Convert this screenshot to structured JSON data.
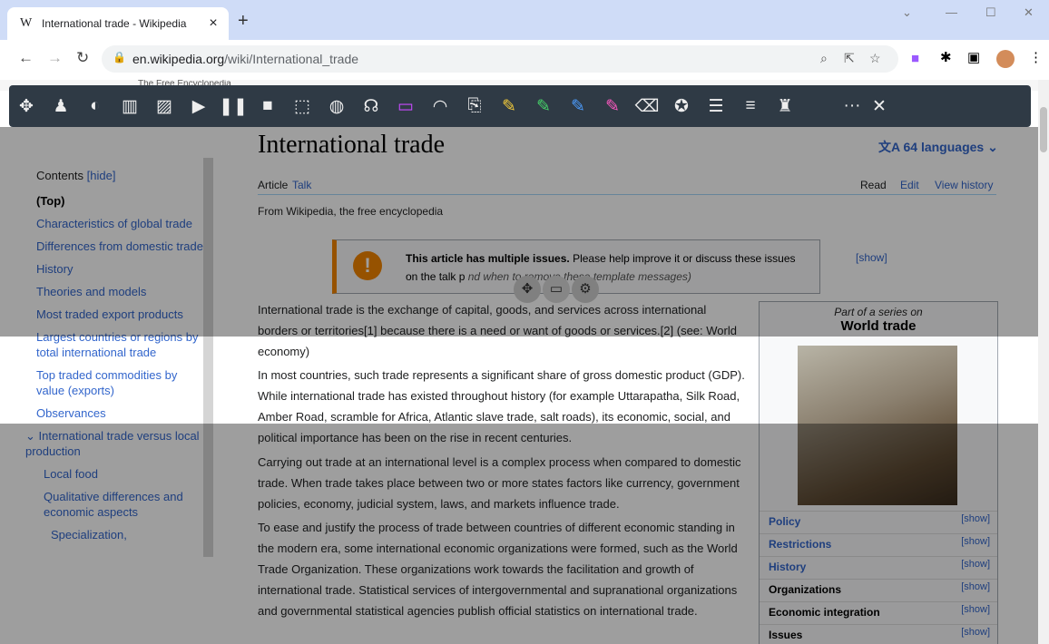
{
  "browser": {
    "tab_title": "International trade - Wikipedia",
    "tab_favicon": "W",
    "tab_close": "×",
    "new_tab": "+",
    "url_host": "en.wikipedia.org",
    "url_path": "/wiki/International_trade",
    "window_controls": [
      "—",
      "☐",
      "✕"
    ]
  },
  "wiki_header_text": "The Free Encyclopedia",
  "toolbar_more": "···",
  "toolbar_close": "✕",
  "sidebar": {
    "contents_label": "Contents",
    "hide": "[hide]",
    "items": [
      "(Top)",
      "Characteristics of global trade",
      "Differences from domestic trade",
      "History",
      "Theories and models",
      "Most traded export products",
      "Largest countries or regions by total international trade",
      "Top traded commodities by value (exports)",
      "Observances",
      "International trade versus local production",
      "Local food",
      "Qualitative differences and economic aspects",
      "Specialization,"
    ]
  },
  "article": {
    "title": "International trade",
    "languages": "64 languages",
    "tab_article": "Article",
    "tab_talk": "Talk",
    "tab_read": "Read",
    "tab_edit": "Edit",
    "tab_history": "View history",
    "tagline": "From Wikipedia, the free encyclopedia",
    "notice_bold": "This article has multiple issues.",
    "notice_text": " Please help improve it or discuss these issues on the talk p",
    "notice_italic": "nd when to remove these template messages)",
    "notice_show": "[show]",
    "para1": "International trade is the exchange of capital, goods, and services across international borders or territories[1] because there is a need or want of goods or services.[2] (see: World economy)",
    "para2": "In most countries, such trade represents a significant share of gross domestic product (GDP). While international trade has existed throughout history (for example Uttarapatha, Silk Road, Amber Road, scramble for Africa, Atlantic slave trade, salt roads), its economic, social, and political importance has been on the rise in recent centuries.",
    "para3": "Carrying out trade at an international level is a complex process when compared to domestic trade. When trade takes place between two or more states factors like currency, government policies, economy, judicial system, laws, and markets influence trade.",
    "para4": "To ease and justify the process of trade between countries of different economic standing in the modern era, some international economic organizations were formed, such as the World Trade Organization. These organizations work towards the facilitation and growth of international trade. Statistical services of intergovernmental and supranational organizations and governmental statistical agencies publish official statistics on international trade."
  },
  "infobox": {
    "pre": "Part of a series on",
    "title": "World trade",
    "rows": [
      {
        "label": "Policy",
        "show": "[show]"
      },
      {
        "label": "Restrictions",
        "show": "[show]"
      },
      {
        "label": "History",
        "show": "[show]"
      },
      {
        "label": "Organizations",
        "show": "[show]"
      },
      {
        "label": "Economic integration",
        "show": "[show]"
      },
      {
        "label": "Issues",
        "show": "[show]"
      }
    ]
  }
}
